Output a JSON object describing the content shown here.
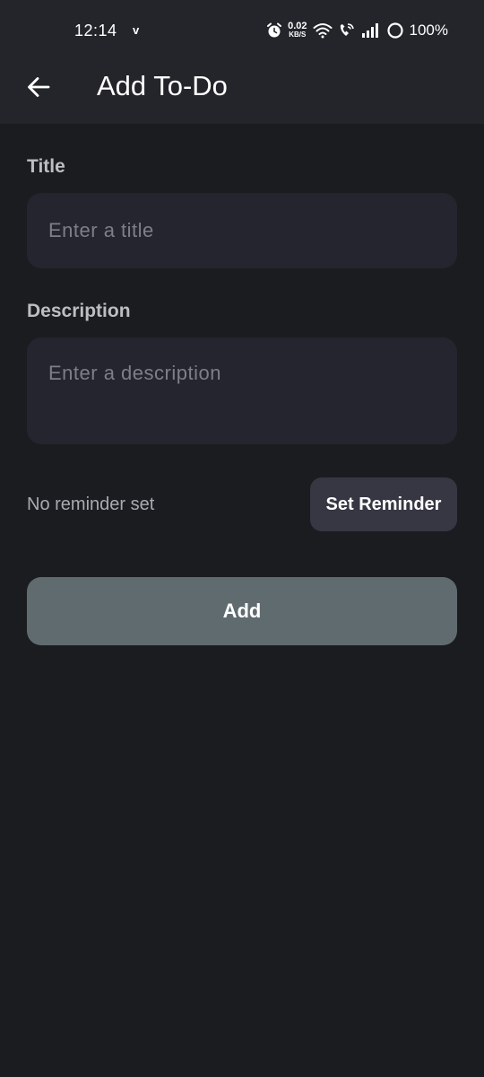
{
  "status_bar": {
    "time": "12:14",
    "notification_glyph": "v",
    "net_speed_value": "0.02",
    "net_speed_unit": "KB/S",
    "battery_percent": "100%",
    "icons": [
      "alarm-icon",
      "wifi-icon",
      "wifi-calling-icon",
      "signal-icon",
      "battery-icon"
    ]
  },
  "app_bar": {
    "title": "Add To-Do",
    "back_icon": "arrow-left-icon"
  },
  "form": {
    "title_label": "Title",
    "title_placeholder": "Enter a title",
    "title_value": "",
    "description_label": "Description",
    "description_placeholder": "Enter a description",
    "description_value": ""
  },
  "reminder": {
    "status_text": "No reminder set",
    "button_label": "Set Reminder"
  },
  "actions": {
    "add_label": "Add"
  },
  "colors": {
    "background": "#1b1c20",
    "header": "#24252b",
    "input_bg": "#24252e",
    "reminder_button": "#363743",
    "add_button": "#606b70"
  }
}
